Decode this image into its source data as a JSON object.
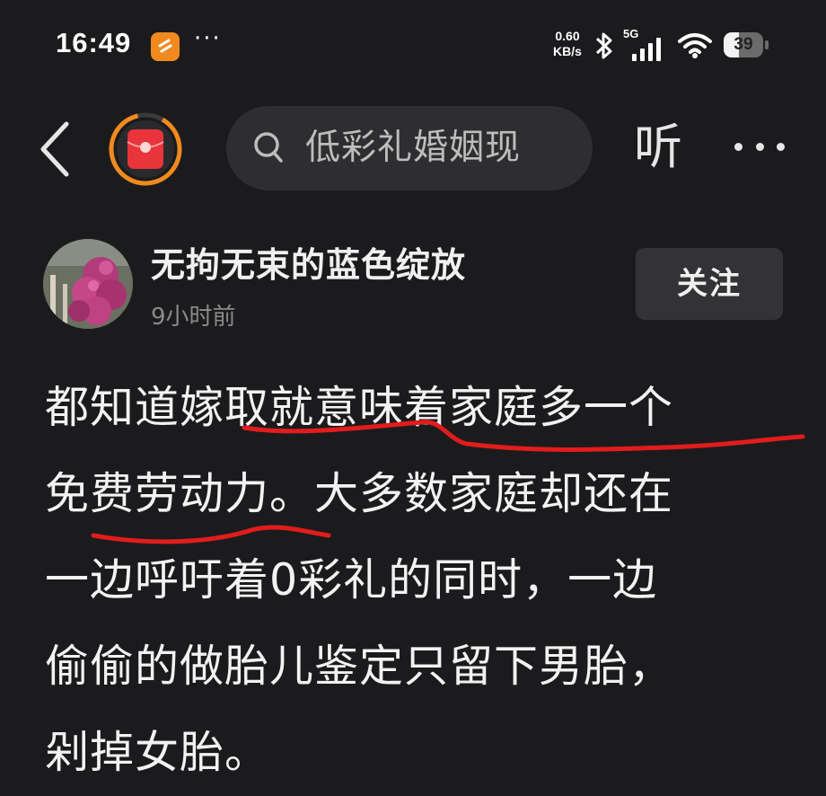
{
  "status_bar": {
    "time": "16:49",
    "more_dots": "···",
    "net_speed_value": "0.60",
    "net_speed_unit": "KB/s",
    "network": "5G",
    "battery": "39",
    "battery_level": 0.39
  },
  "nav": {
    "search_text": "低彩礼婚姻现",
    "listen_label": "听"
  },
  "author": {
    "name": "无拘无束的蓝色绽放",
    "time_ago": "9小时前",
    "follow_label": "关注"
  },
  "post": {
    "lines": [
      "都知道嫁取就意味着家庭多一个",
      "免费劳动力。大多数家庭却还在",
      "一边呼吁着0彩礼的同时，一边",
      "偷偷的做胎儿鉴定只留下男胎，",
      "剁掉女胎。"
    ]
  },
  "colors": {
    "background": "#1b1b1d",
    "app_icon": "#f08a1e",
    "red_envelope": "#e8343a",
    "progress_ring": "#f08a1e",
    "annotation_red": "#e21c1c"
  }
}
